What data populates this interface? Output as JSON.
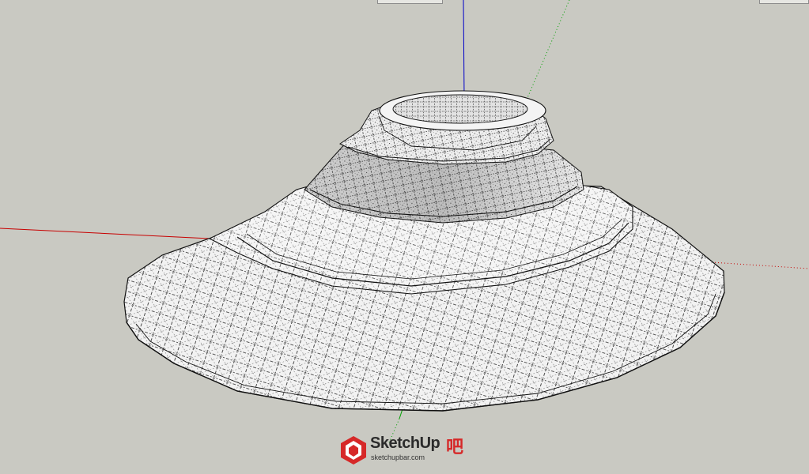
{
  "app": "SketchUp",
  "scene": {
    "background_color": "#c9c9c2",
    "model": "bowl-shaped surface mesh with dashed hidden geometry",
    "axes": {
      "red": "#c80000",
      "green": "#00a000",
      "blue": "#0000c8"
    }
  },
  "watermark": {
    "title": "SketchUp",
    "suffix": "吧",
    "url": "sketchupbar.com",
    "logo_icon": "sketchup-logo-icon",
    "logo_color": "#d62828"
  }
}
